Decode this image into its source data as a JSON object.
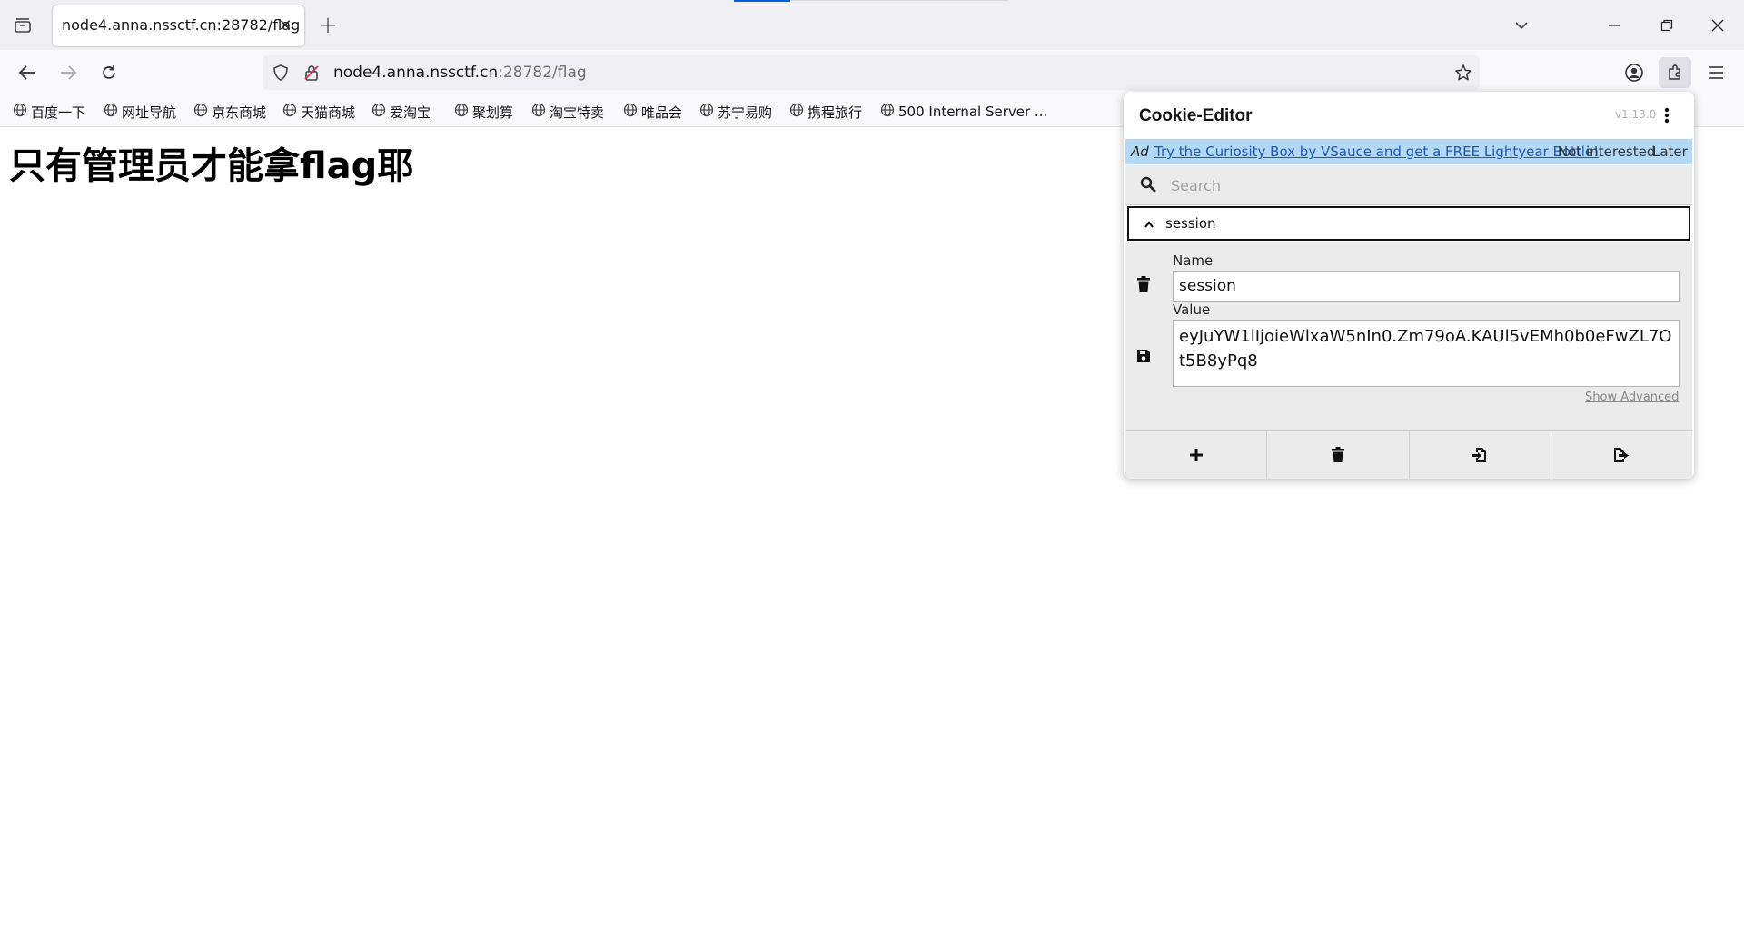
{
  "browser": {
    "tab": {
      "title": "node4.anna.nssctf.cn:28782/flag"
    },
    "url": {
      "scheme": "",
      "host": "node4.anna.nssctf.cn",
      "path": ":28782/flag"
    },
    "bookmarks": [
      {
        "label": "百度一下"
      },
      {
        "label": "网址导航"
      },
      {
        "label": "京东商城"
      },
      {
        "label": "天猫商城"
      },
      {
        "label": "爱淘宝"
      },
      {
        "label": "聚划算"
      },
      {
        "label": "淘宝特卖"
      },
      {
        "label": "唯品会"
      },
      {
        "label": "苏宁易购"
      },
      {
        "label": "携程旅行"
      },
      {
        "label": "500 Internal Server ..."
      }
    ]
  },
  "page": {
    "heading": "只有管理员才能拿flag耶"
  },
  "cookie_editor": {
    "title": "Cookie-Editor",
    "version": "v1.13.0",
    "ad": {
      "tag": "Ad",
      "link": "Try the Curiosity Box by VSauce and get a FREE Lightyear Bottle!",
      "dismiss": "Not interested",
      "later": "Later"
    },
    "search_placeholder": "Search",
    "cookie": {
      "header_name": "session",
      "name_label": "Name",
      "name_value": "session",
      "value_label": "Value",
      "value": "eyJuYW1lIjoieWlxaW5nIn0.Zm79oA.KAUl5vEMh0b0eFwZL7Ot5B8yPq8"
    },
    "show_advanced": "Show Advanced"
  }
}
